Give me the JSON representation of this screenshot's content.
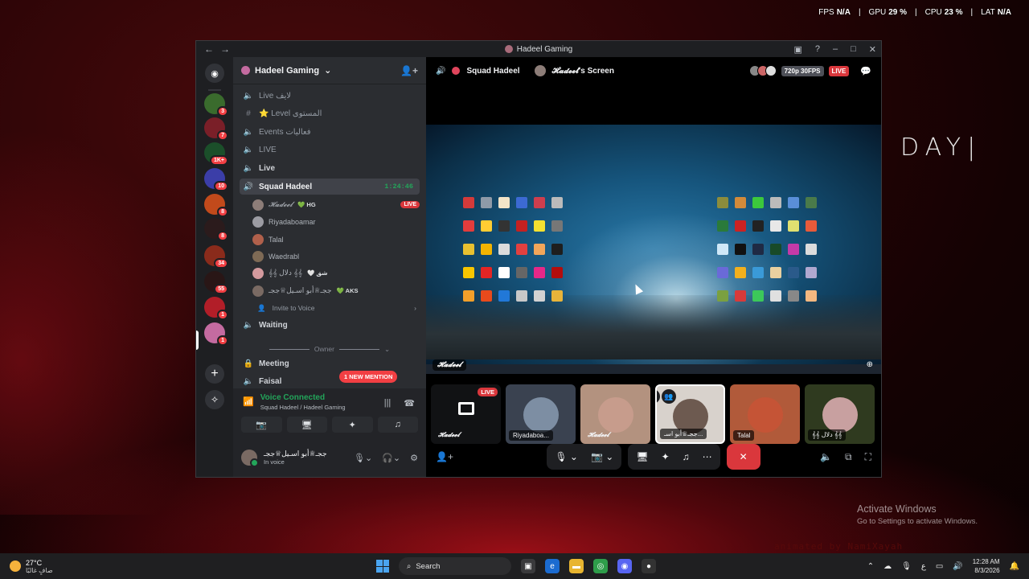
{
  "perf": {
    "fps_label": "FPS",
    "fps": "N/A",
    "gpu_label": "GPU",
    "gpu": "29 %",
    "cpu_label": "CPU",
    "cpu": "23 %",
    "lat_label": "LAT",
    "lat": "N/A"
  },
  "wallpaper": {
    "text": "DAY|",
    "activate_title": "Activate Windows",
    "activate_sub": "Go to Settings to activate Windows.",
    "credit": "animated by NamiXayah"
  },
  "window": {
    "title": "Hadeel Gaming"
  },
  "guild": {
    "name": "Hadeel Gaming"
  },
  "channels": [
    {
      "label": "Live  لايف",
      "icon": "🔈",
      "style": "light"
    },
    {
      "label": "⭐ Level  المستوى",
      "icon": "#",
      "style": "light"
    },
    {
      "label": "Events  فعاليات",
      "icon": "🔈",
      "style": "light"
    },
    {
      "label": "LIVE",
      "icon": "🔈",
      "style": ""
    },
    {
      "label": "Live",
      "icon": "🔈",
      "style": "bold"
    },
    {
      "label": "Squad Hadeel",
      "icon": "🔊",
      "style": "active",
      "timer": "1:24:46"
    }
  ],
  "voice_users": [
    {
      "name": "𝓗𝓪𝓭𝓮𝓮𝓵",
      "tag": "💚 HG",
      "live": "LIVE",
      "color": "#8d7d78"
    },
    {
      "name": "Riyadaboamar",
      "tag": "",
      "live": "",
      "color": "#9c9ca3"
    },
    {
      "name": "Talal",
      "tag": "",
      "live": "",
      "color": "#b0604b"
    },
    {
      "name": "Waedrabl",
      "tag": "",
      "live": "",
      "color": "#7e6a55"
    },
    {
      "name": "𝄞𝄞 دلال 𝄞𝄞",
      "tag": "🤍 شق",
      "live": "",
      "color": "#d49a9e"
    },
    {
      "name": "ججـ♕أبو اسـيل♕ججـ",
      "tag": "💚 AKS",
      "live": "",
      "color": "#7a6a63"
    }
  ],
  "invite_to_voice": "Invite to Voice",
  "waiting": "Waiting",
  "owner_category": "Owner",
  "meeting": "Meeting",
  "faisal": "Faisal",
  "new_mention": "1 NEW MENTION",
  "voice": {
    "status": "Voice Connected",
    "location": "Squad Hadeel / Hadeel Gaming"
  },
  "account": {
    "name": "ججـ♕أبو اسـيل♕ججـ",
    "status": "In voice"
  },
  "stage": {
    "channel": "Squad Hadeel",
    "screen_title": "𝓗𝓪𝓭𝓮𝓮𝓵's Screen",
    "quality": "720p 30FPS",
    "live": "LIVE",
    "owner_tag": "𝓗𝓪𝓭𝓮𝓮𝓵"
  },
  "tiles": [
    {
      "label": "𝓗𝓪𝓭𝓮𝓮𝓵",
      "kind": "screen",
      "live": "LIVE",
      "color": "#000000"
    },
    {
      "label": "Riyadaboa...",
      "kind": "face",
      "color": "#7d8ea3"
    },
    {
      "label": "𝓗𝓪𝓭𝓮𝓮𝓵",
      "kind": "face",
      "color": "#c79c8c"
    },
    {
      "label": "ججـ♕أبو اسـ...",
      "kind": "face",
      "color": "#6d5a50"
    },
    {
      "label": "Talal",
      "kind": "face",
      "color": "#c55436"
    },
    {
      "label": "𝄞𝄞 دلال 𝄞𝄞",
      "kind": "face",
      "color": "#4c5a2c"
    }
  ],
  "taskbar": {
    "temp": "27°C",
    "weather": "صافٍ غالبًا",
    "search": "Search",
    "time": "12:28 AM",
    "date": "8/3/2026",
    "lang": "ع"
  }
}
